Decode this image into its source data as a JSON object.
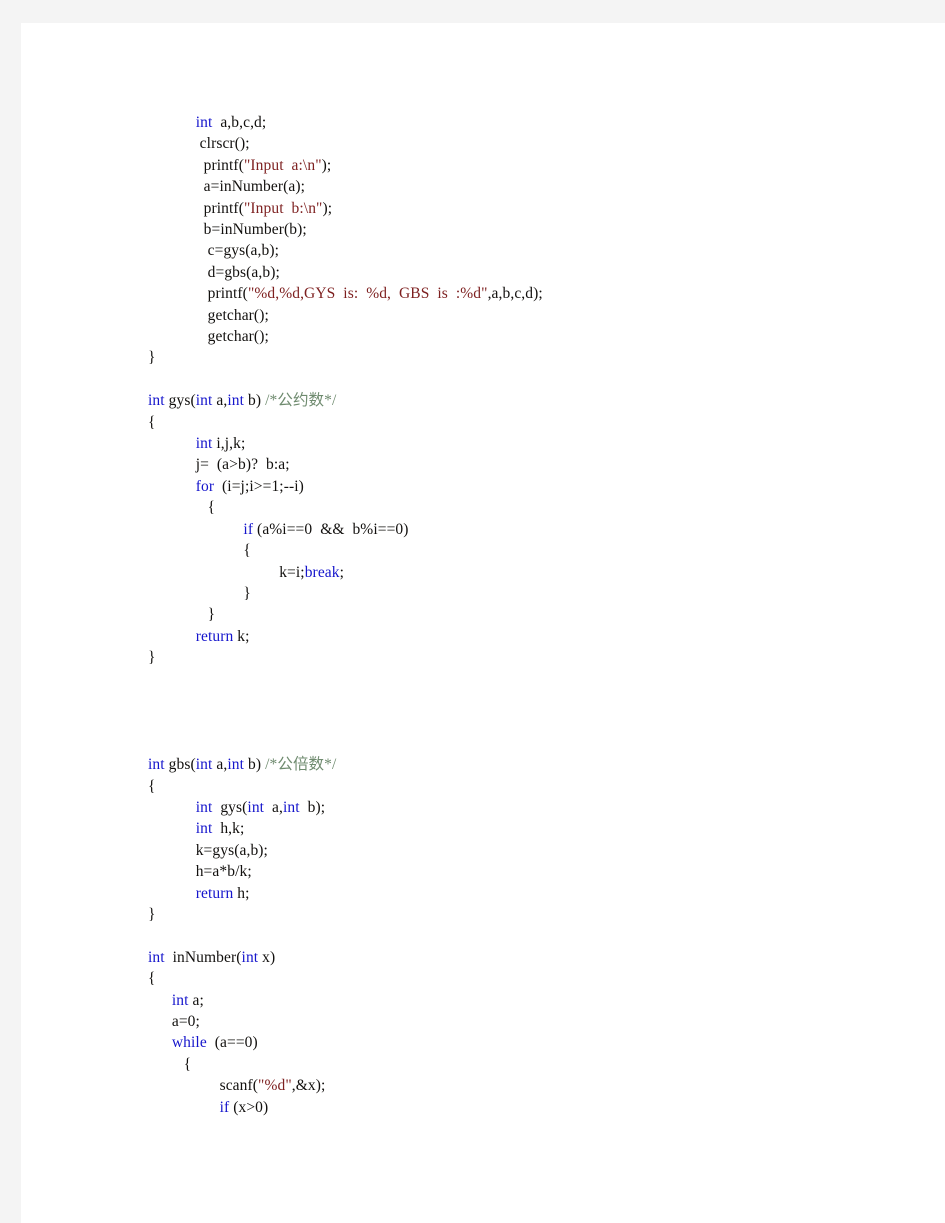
{
  "page": {
    "background_color": "#f4f4f4",
    "sheet_color": "#ffffff",
    "title": "C source listing"
  },
  "colors": {
    "keyword": "#1515cc",
    "string": "#7d1f1f",
    "comment": "#6f8b6f",
    "plain": "#12100e"
  },
  "code": {
    "language": "C",
    "lines": [
      {
        "indent": 4,
        "tokens": [
          {
            "t": "int",
            "c": "kw"
          },
          {
            "t": "  a,b,c,d;",
            "c": "plain"
          }
        ]
      },
      {
        "indent": 4,
        "tokens": [
          {
            "t": " clrscr();",
            "c": "plain"
          }
        ]
      },
      {
        "indent": 4,
        "tokens": [
          {
            "t": "  printf(",
            "c": "plain"
          },
          {
            "t": "\"Input  a:\\n\"",
            "c": "str"
          },
          {
            "t": ");",
            "c": "plain"
          }
        ]
      },
      {
        "indent": 4,
        "tokens": [
          {
            "t": "  a=inNumber(a);",
            "c": "plain"
          }
        ]
      },
      {
        "indent": 4,
        "tokens": [
          {
            "t": "  printf(",
            "c": "plain"
          },
          {
            "t": "\"Input  b:\\n\"",
            "c": "str"
          },
          {
            "t": ");",
            "c": "plain"
          }
        ]
      },
      {
        "indent": 4,
        "tokens": [
          {
            "t": "  b=inNumber(b);",
            "c": "plain"
          }
        ]
      },
      {
        "indent": 4,
        "tokens": [
          {
            "t": "   c=gys(a,b);",
            "c": "plain"
          }
        ]
      },
      {
        "indent": 4,
        "tokens": [
          {
            "t": "   d=gbs(a,b);",
            "c": "plain"
          }
        ]
      },
      {
        "indent": 4,
        "tokens": [
          {
            "t": "   printf(",
            "c": "plain"
          },
          {
            "t": "\"%d,%d,GYS  is:  %d,  GBS  is  :%d\"",
            "c": "str"
          },
          {
            "t": ",a,b,c,d);",
            "c": "plain"
          }
        ]
      },
      {
        "indent": 4,
        "tokens": [
          {
            "t": "   getchar();",
            "c": "plain"
          }
        ]
      },
      {
        "indent": 4,
        "tokens": [
          {
            "t": "   getchar();",
            "c": "plain"
          }
        ]
      },
      {
        "indent": 0,
        "tokens": [
          {
            "t": "}",
            "c": "plain"
          }
        ]
      },
      {
        "indent": 0,
        "tokens": []
      },
      {
        "indent": 0,
        "tokens": [
          {
            "t": "int",
            "c": "kw"
          },
          {
            "t": " gys(",
            "c": "plain"
          },
          {
            "t": "int",
            "c": "kw"
          },
          {
            "t": " a,",
            "c": "plain"
          },
          {
            "t": "int",
            "c": "kw"
          },
          {
            "t": " b) ",
            "c": "plain"
          },
          {
            "t": "/*公约数*/",
            "c": "comment"
          }
        ]
      },
      {
        "indent": 0,
        "tokens": [
          {
            "t": "{",
            "c": "plain"
          }
        ]
      },
      {
        "indent": 4,
        "tokens": [
          {
            "t": "int",
            "c": "kw"
          },
          {
            "t": " i,j,k;",
            "c": "plain"
          }
        ]
      },
      {
        "indent": 4,
        "tokens": [
          {
            "t": "j=  (a>b)?  b:a;",
            "c": "plain"
          }
        ]
      },
      {
        "indent": 4,
        "tokens": [
          {
            "t": "for",
            "c": "kw"
          },
          {
            "t": "  (i=j;i>=1;--i)",
            "c": "plain"
          }
        ]
      },
      {
        "indent": 5,
        "tokens": [
          {
            "t": "{",
            "c": "plain"
          }
        ]
      },
      {
        "indent": 8,
        "tokens": [
          {
            "t": "if",
            "c": "kw"
          },
          {
            "t": " (a%i==0  &&  b%i==0)",
            "c": "plain"
          }
        ]
      },
      {
        "indent": 8,
        "tokens": [
          {
            "t": "{",
            "c": "plain"
          }
        ]
      },
      {
        "indent": 11,
        "tokens": [
          {
            "t": "k=i;",
            "c": "plain"
          },
          {
            "t": "break",
            "c": "kw"
          },
          {
            "t": ";",
            "c": "plain"
          }
        ]
      },
      {
        "indent": 8,
        "tokens": [
          {
            "t": "}",
            "c": "plain"
          }
        ]
      },
      {
        "indent": 5,
        "tokens": [
          {
            "t": "}",
            "c": "plain"
          }
        ]
      },
      {
        "indent": 4,
        "tokens": [
          {
            "t": "return",
            "c": "kw"
          },
          {
            "t": " k;",
            "c": "plain"
          }
        ]
      },
      {
        "indent": 0,
        "tokens": [
          {
            "t": "}",
            "c": "plain"
          }
        ]
      },
      {
        "indent": 0,
        "tokens": []
      },
      {
        "indent": 0,
        "tokens": []
      },
      {
        "indent": 0,
        "tokens": []
      },
      {
        "indent": 0,
        "tokens": []
      },
      {
        "indent": 0,
        "tokens": [
          {
            "t": "int",
            "c": "kw"
          },
          {
            "t": " gbs(",
            "c": "plain"
          },
          {
            "t": "int",
            "c": "kw"
          },
          {
            "t": " a,",
            "c": "plain"
          },
          {
            "t": "int",
            "c": "kw"
          },
          {
            "t": " b) ",
            "c": "plain"
          },
          {
            "t": "/*公倍数*/",
            "c": "comment"
          }
        ]
      },
      {
        "indent": 0,
        "tokens": [
          {
            "t": "{",
            "c": "plain"
          }
        ]
      },
      {
        "indent": 4,
        "tokens": [
          {
            "t": "int",
            "c": "kw"
          },
          {
            "t": "  gys(",
            "c": "plain"
          },
          {
            "t": "int",
            "c": "kw"
          },
          {
            "t": "  a,",
            "c": "plain"
          },
          {
            "t": "int",
            "c": "kw"
          },
          {
            "t": "  b);",
            "c": "plain"
          }
        ]
      },
      {
        "indent": 4,
        "tokens": [
          {
            "t": "int",
            "c": "kw"
          },
          {
            "t": "  h,k;",
            "c": "plain"
          }
        ]
      },
      {
        "indent": 4,
        "tokens": [
          {
            "t": "k=gys(a,b);",
            "c": "plain"
          }
        ]
      },
      {
        "indent": 4,
        "tokens": [
          {
            "t": "h=a*b/k;",
            "c": "plain"
          }
        ]
      },
      {
        "indent": 4,
        "tokens": [
          {
            "t": "return",
            "c": "kw"
          },
          {
            "t": " h;",
            "c": "plain"
          }
        ]
      },
      {
        "indent": 0,
        "tokens": [
          {
            "t": "}",
            "c": "plain"
          }
        ]
      },
      {
        "indent": 0,
        "tokens": []
      },
      {
        "indent": 0,
        "tokens": [
          {
            "t": "int",
            "c": "kw"
          },
          {
            "t": "  inNumber(",
            "c": "plain"
          },
          {
            "t": "int",
            "c": "kw"
          },
          {
            "t": " x)",
            "c": "plain"
          }
        ]
      },
      {
        "indent": 0,
        "tokens": [
          {
            "t": "{",
            "c": "plain"
          }
        ]
      },
      {
        "indent": 2,
        "tokens": [
          {
            "t": "int",
            "c": "kw"
          },
          {
            "t": " a;",
            "c": "plain"
          }
        ]
      },
      {
        "indent": 2,
        "tokens": [
          {
            "t": "a=0;",
            "c": "plain"
          }
        ]
      },
      {
        "indent": 2,
        "tokens": [
          {
            "t": "while",
            "c": "kw"
          },
          {
            "t": "  (a==0)",
            "c": "plain"
          }
        ]
      },
      {
        "indent": 3,
        "tokens": [
          {
            "t": "{",
            "c": "plain"
          }
        ]
      },
      {
        "indent": 6,
        "tokens": [
          {
            "t": "scanf(",
            "c": "plain"
          },
          {
            "t": "\"%d\"",
            "c": "str"
          },
          {
            "t": ",&x);",
            "c": "plain"
          }
        ]
      },
      {
        "indent": 6,
        "tokens": [
          {
            "t": "if",
            "c": "kw"
          },
          {
            "t": " (x>0)",
            "c": "plain"
          }
        ]
      }
    ]
  }
}
